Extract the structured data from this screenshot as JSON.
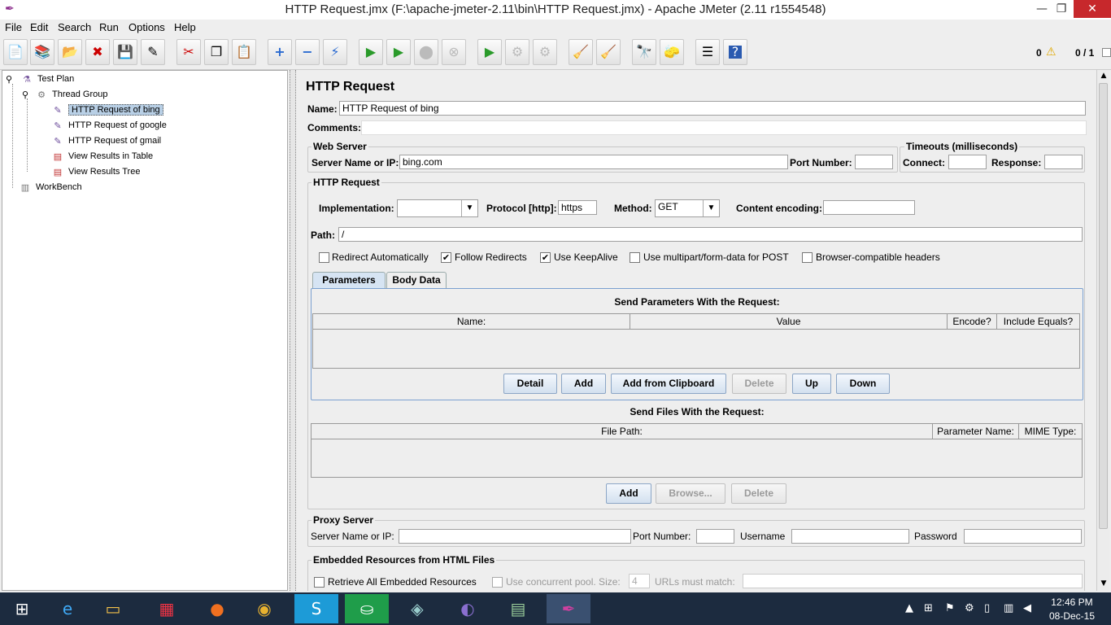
{
  "window": {
    "title": "HTTP Request.jmx (F:\\apache-jmeter-2.11\\bin\\HTTP Request.jmx) - Apache JMeter (2.11 r1554548)",
    "min": "—",
    "max": "❐",
    "close": "✕"
  },
  "menu": [
    "File",
    "Edit",
    "Search",
    "Run",
    "Options",
    "Help"
  ],
  "status": {
    "warnings": "0",
    "threads": "0 / 1"
  },
  "tree": {
    "test_plan": "Test Plan",
    "thread_group": "Thread Group",
    "items": [
      "HTTP Request of bing",
      "HTTP Request of google",
      "HTTP Request of gmail",
      "View Results in Table",
      "View Results Tree"
    ],
    "workbench": "WorkBench"
  },
  "panel": {
    "title": "HTTP Request",
    "name_label": "Name:",
    "name_value": "HTTP Request of bing",
    "comments_label": "Comments:",
    "web_server": {
      "legend": "Web Server",
      "server_label": "Server Name or IP:",
      "server_value": "bing.com",
      "port_label": "Port Number:"
    },
    "timeouts": {
      "legend": "Timeouts (milliseconds)",
      "connect_label": "Connect:",
      "response_label": "Response:"
    },
    "http_request": {
      "legend": "HTTP Request",
      "impl_label": "Implementation:",
      "protocol_label": "Protocol [http]:",
      "protocol_value": "https",
      "method_label": "Method:",
      "method_value": "GET",
      "encoding_label": "Content encoding:",
      "path_label": "Path:",
      "path_value": "/"
    },
    "options": [
      {
        "label": "Redirect Automatically",
        "checked": false
      },
      {
        "label": "Follow Redirects",
        "checked": true
      },
      {
        "label": "Use KeepAlive",
        "checked": true
      },
      {
        "label": "Use multipart/form-data for POST",
        "checked": false
      },
      {
        "label": "Browser-compatible headers",
        "checked": false
      }
    ],
    "tabs": [
      "Parameters",
      "Body Data"
    ],
    "params": {
      "heading": "Send Parameters With the Request:",
      "columns": [
        "Name:",
        "Value",
        "Encode?",
        "Include Equals?"
      ],
      "buttons": [
        "Detail",
        "Add",
        "Add from Clipboard",
        "Delete",
        "Up",
        "Down"
      ]
    },
    "files": {
      "heading": "Send Files With the Request:",
      "columns": [
        "File Path:",
        "Parameter Name:",
        "MIME Type:"
      ],
      "buttons": [
        "Add",
        "Browse...",
        "Delete"
      ]
    },
    "proxy": {
      "legend": "Proxy Server",
      "server_label": "Server Name or IP:",
      "port_label": "Port Number:",
      "user_label": "Username",
      "pass_label": "Password"
    },
    "embedded": {
      "legend": "Embedded Resources from HTML Files",
      "retrieve_label": "Retrieve All Embedded Resources",
      "pool_label": "Use concurrent pool. Size:",
      "pool_value": "4",
      "urls_label": "URLs must match:"
    }
  },
  "taskbar": {
    "time": "12:46 PM",
    "date": "08-Dec-15"
  }
}
